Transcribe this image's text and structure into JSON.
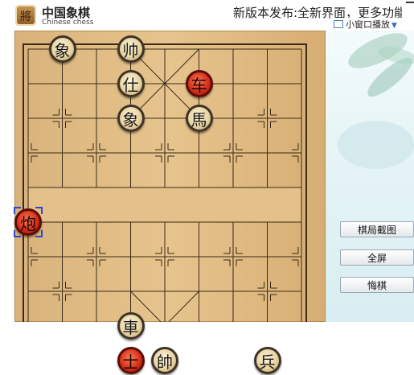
{
  "header": {
    "logo_glyph": "將",
    "title": "中国象棋",
    "subtitle": "Chinese chess",
    "notice": "新版本发布:全新界面，更多功能。",
    "mini_window_label": "小窗口播放"
  },
  "side_buttons": {
    "capture": "棋局截图",
    "fullscreen": "全屏",
    "undo": "悔棋"
  },
  "board": {
    "river_text": "",
    "pieces": [
      {
        "label": "象",
        "color": "black",
        "col": 1,
        "row": 0
      },
      {
        "label": "帅",
        "color": "black",
        "col": 3,
        "row": 0
      },
      {
        "label": "仕",
        "color": "black",
        "col": 3,
        "row": 1
      },
      {
        "label": "车",
        "color": "red",
        "col": 5,
        "row": 1
      },
      {
        "label": "象",
        "color": "black",
        "col": 3,
        "row": 2
      },
      {
        "label": "馬",
        "color": "black",
        "col": 5,
        "row": 2
      },
      {
        "label": "炮",
        "color": "red",
        "col": 0,
        "row": 5,
        "selected": true
      },
      {
        "label": "車",
        "color": "black",
        "col": 3,
        "row": 8
      },
      {
        "label": "士",
        "color": "red",
        "col": 3,
        "row": 9
      },
      {
        "label": "帥",
        "color": "black",
        "col": 4,
        "row": 9
      },
      {
        "label": "兵",
        "color": "black",
        "col": 7,
        "row": 9
      }
    ]
  },
  "colors": {
    "board_wood": "#e7c48d",
    "grid_line": "#3a2a17",
    "red_piece": "#d02a15",
    "black_piece_border": "#3e3326",
    "selection": "#2b49c9"
  }
}
